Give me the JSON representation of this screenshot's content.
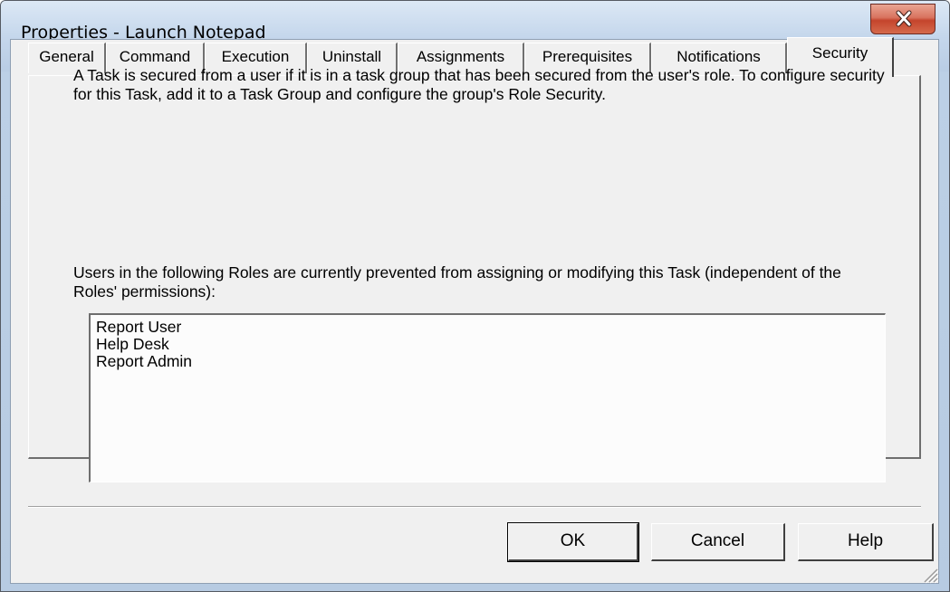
{
  "window": {
    "title": "Properties - Launch Notepad"
  },
  "tabs": [
    {
      "label": "General",
      "selected": false
    },
    {
      "label": "Command",
      "selected": false
    },
    {
      "label": "Execution",
      "selected": false
    },
    {
      "label": "Uninstall",
      "selected": false
    },
    {
      "label": "Assignments",
      "selected": false
    },
    {
      "label": "Prerequisites",
      "selected": false
    },
    {
      "label": "Notifications",
      "selected": false
    },
    {
      "label": "Security",
      "selected": true
    }
  ],
  "security": {
    "description": "A Task is secured from a user if it is in a task group that has been secured from the user's role. To configure security for this Task, add it to a Task Group and configure the group's Role Security.",
    "roles_intro": "Users in the following Roles are currently prevented from assigning or modifying this Task (independent of the Roles' permissions):",
    "roles": [
      "Report User",
      "Help Desk",
      "Report Admin"
    ]
  },
  "buttons": {
    "ok": "OK",
    "cancel": "Cancel",
    "help": "Help"
  },
  "colors": {
    "close_button": "#c4442c",
    "dialog_background": "#f0f0f0",
    "frame": "#b9cde4"
  },
  "icons": {
    "close": "close-icon",
    "resize": "resize-grip-icon"
  }
}
